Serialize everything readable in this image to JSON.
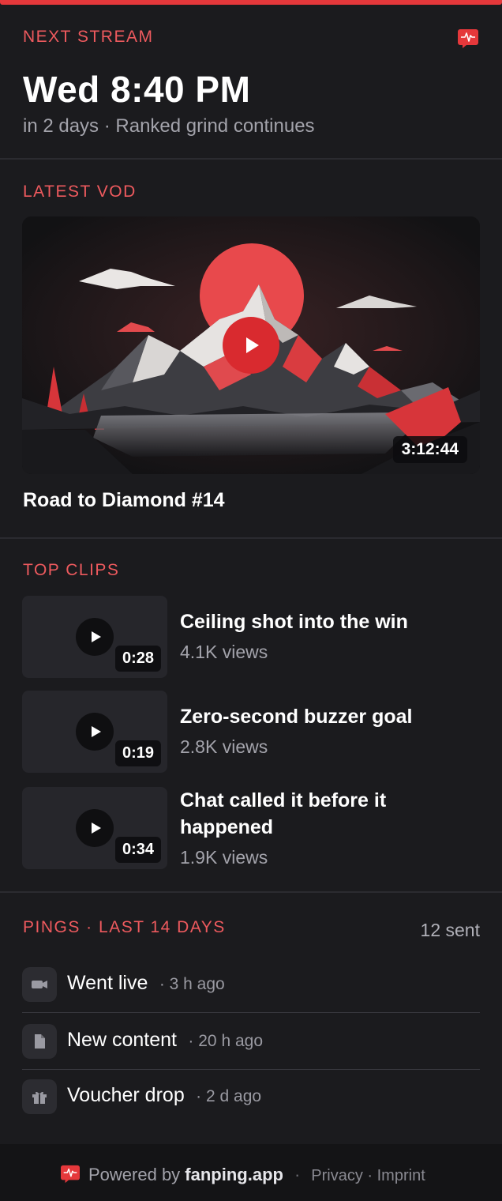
{
  "next_stream": {
    "heading": "NEXT STREAM",
    "time": "Wed 8:40 PM",
    "subline": "in 2 days · Ranked grind continues",
    "badge_icon": "pulse-icon"
  },
  "latest_vod": {
    "heading": "LATEST VOD",
    "title": "Road to Diamond #14",
    "duration": "3:12:44",
    "thumbnail_icon": "mountain-sunset-artwork",
    "play_icon": "play-icon"
  },
  "top_clips": {
    "heading": "TOP CLIPS",
    "items": [
      {
        "title": "Ceiling shot into the win",
        "views": "4.1K views",
        "duration": "0:28"
      },
      {
        "title": "Zero-second buzzer goal",
        "views": "2.8K views",
        "duration": "0:19"
      },
      {
        "title": "Chat called it before it happened",
        "views": "1.9K views",
        "duration": "0:34"
      }
    ]
  },
  "pings": {
    "heading": "PINGS · LAST 14 DAYS",
    "count": "12 sent",
    "items": [
      {
        "label": "Went live",
        "time": "· 3 h ago",
        "icon": "video-camera-icon"
      },
      {
        "label": "New content",
        "time": "· 20 h ago",
        "icon": "document-icon"
      },
      {
        "label": "Voucher drop",
        "time": "· 2 d ago",
        "icon": "gift-icon"
      }
    ]
  },
  "footer": {
    "powered_prefix": "Powered by ",
    "brand": "fanping.app",
    "separator": "·",
    "links": "Privacy · Imprint"
  },
  "colors": {
    "accent": "#e5383b",
    "heading": "#ee5a5e",
    "background": "#1b1b1e"
  }
}
